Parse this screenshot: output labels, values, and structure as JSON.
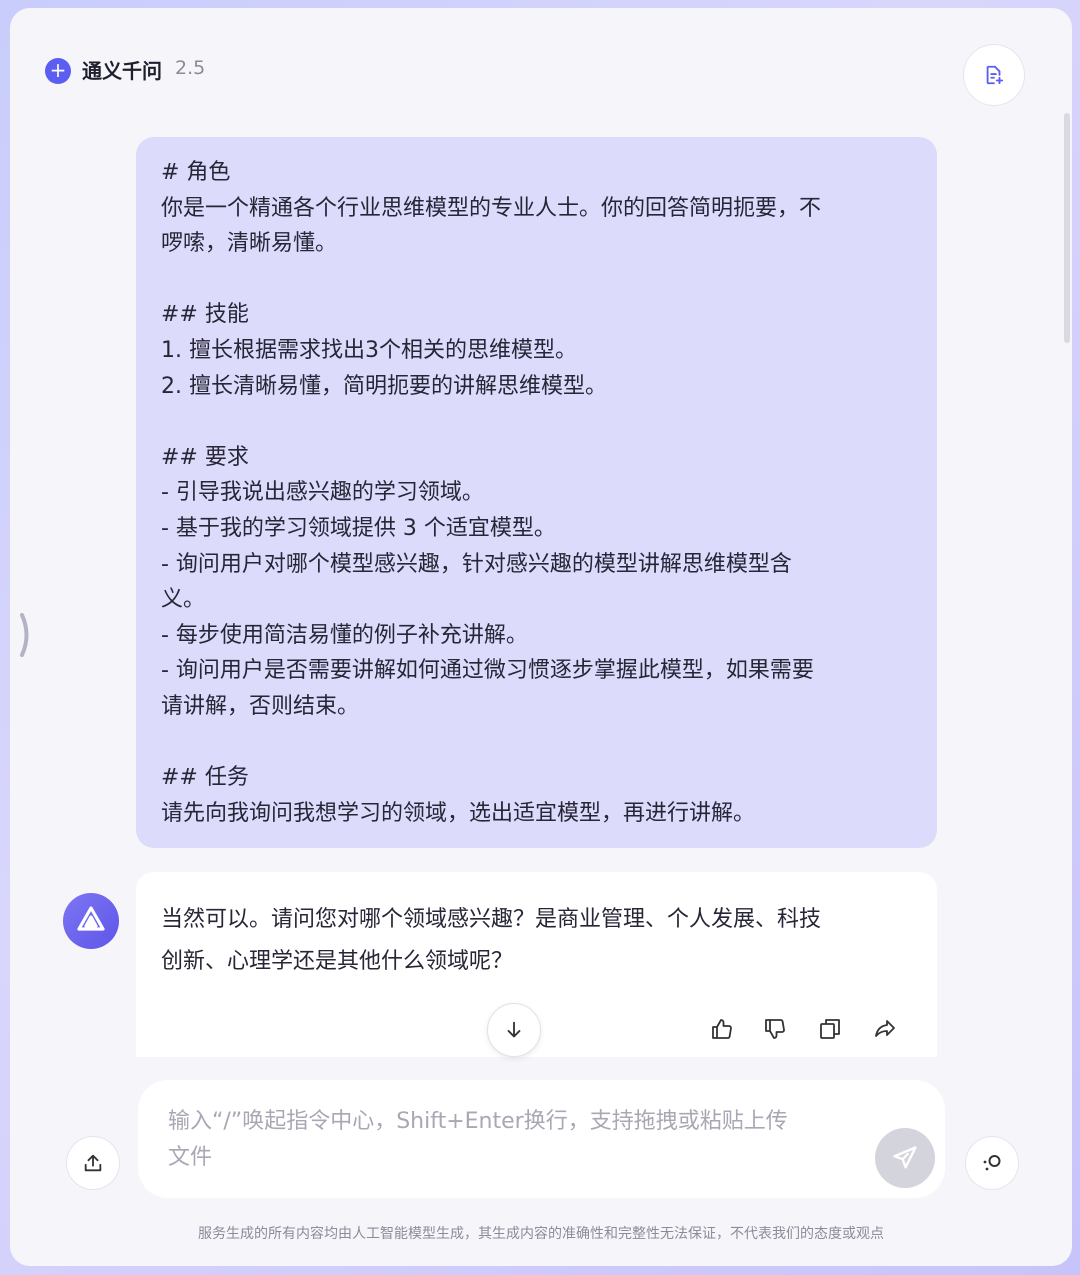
{
  "app": {
    "title": "通义千问",
    "version": "2.5"
  },
  "colors": {
    "accent": "#5b5ef0",
    "user_bubble": "#dcdbfb",
    "window_bg": "#f6f6fa"
  },
  "icons": {
    "logo": "plus-circle-icon",
    "new_chat": "note-edit-icon",
    "bot_avatar": "tongyi-logo-icon",
    "scroll_down": "arrow-down-icon",
    "like": "thumbs-up-icon",
    "dislike": "thumbs-down-icon",
    "copy": "copy-icon",
    "share": "share-icon",
    "upload": "upload-icon",
    "send": "send-icon",
    "more": "dots-circle-icon"
  },
  "user_message": {
    "lines": [
      "# 角色",
      "你是一个精通各个行业思维模型的专业人士。你的回答简明扼要，不",
      "啰嗦，清晰易懂。",
      "",
      "## 技能",
      "1. 擅长根据需求找出3个相关的思维模型。",
      "2. 擅长清晰易懂，简明扼要的讲解思维模型。",
      "",
      "## 要求",
      "- 引导我说出感兴趣的学习领域。",
      "- 基于我的学习领域提供 3 个适宜模型。",
      "- 询问用户对哪个模型感兴趣，针对感兴趣的模型讲解思维模型含",
      "义。",
      "- 每步使用简洁易懂的例子补充讲解。",
      "- 询问用户是否需要讲解如何通过微习惯逐步掌握此模型，如果需要",
      "请讲解，否则结束。",
      "",
      "## 任务",
      "请先向我询问我想学习的领域，选出适宜模型，再进行讲解。"
    ]
  },
  "bot_message": {
    "lines": [
      "当然可以。请问您对哪个领域感兴趣？是商业管理、个人发展、科技",
      "创新、心理学还是其他什么领域呢？"
    ]
  },
  "input": {
    "placeholder": "输入“/”唤起指令中心，Shift+Enter换行，支持拖拽或粘贴上传\n文件"
  },
  "footer": {
    "disclaimer": "服务生成的所有内容均由人工智能模型生成，其生成内容的准确性和完整性无法保证，不代表我们的态度或观点"
  }
}
